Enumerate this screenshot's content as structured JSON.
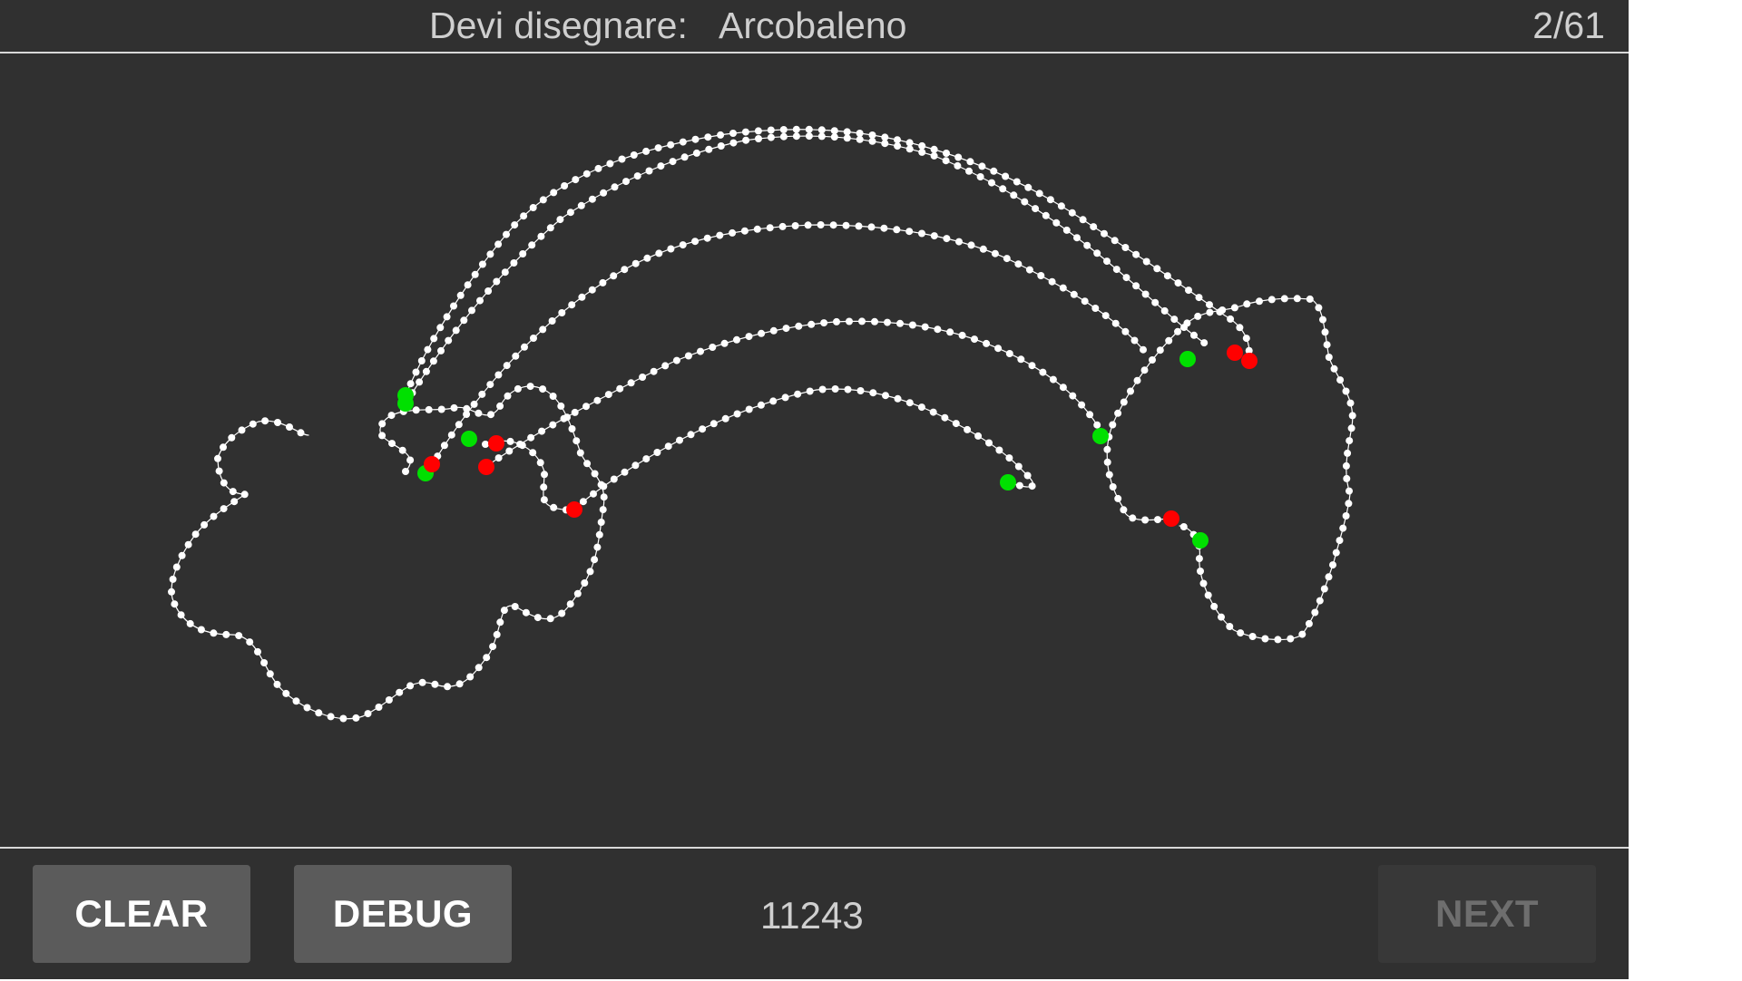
{
  "header": {
    "prompt_label": "Devi disegnare:",
    "prompt_word": "Arcobaleno",
    "progress": "2/61"
  },
  "footer": {
    "clear_label": "CLEAR",
    "debug_label": "DEBUG",
    "score": "11243",
    "next_label": "NEXT"
  },
  "colors": {
    "background": "#303030",
    "stroke": "#ffffff",
    "stroke_start": "#00e000",
    "stroke_end": "#ff0000",
    "button": "#5b5b5b",
    "button_disabled": "#383838"
  }
}
